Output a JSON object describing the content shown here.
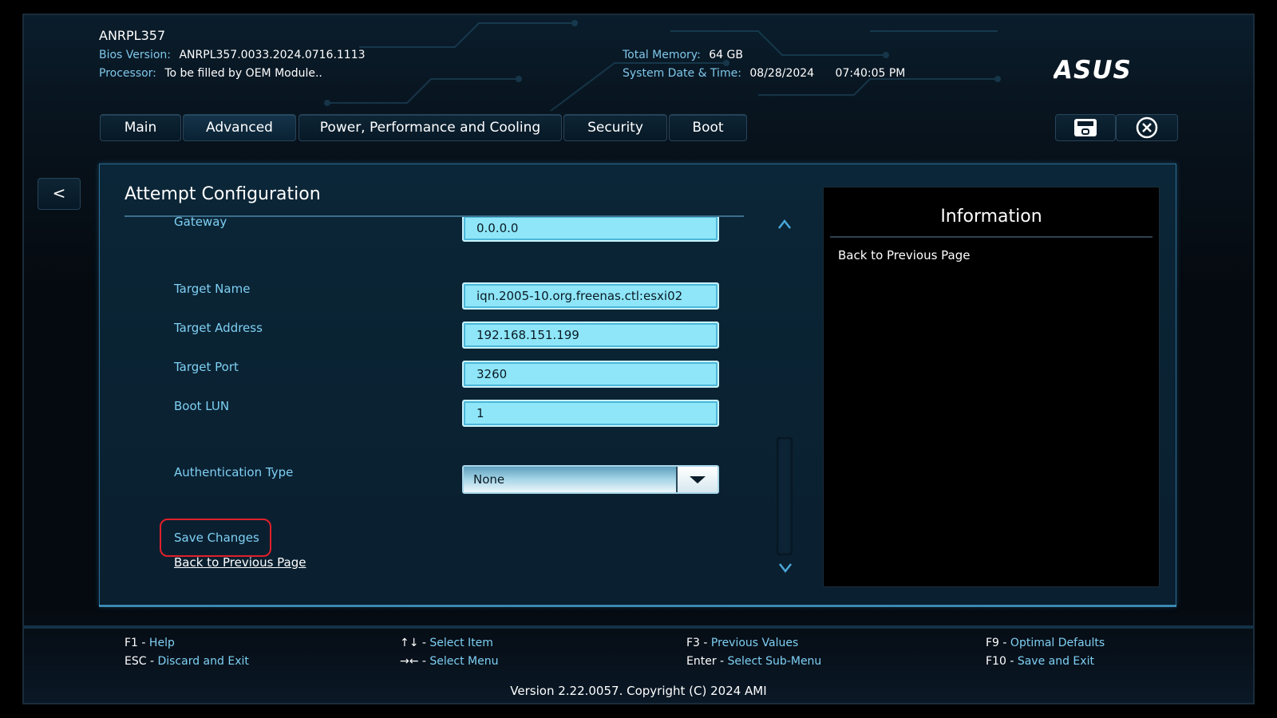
{
  "header": {
    "model": "ANRPL357",
    "bios_version_label": "Bios Version:",
    "bios_version_value": "ANRPL357.0033.2024.0716.1113",
    "processor_label": "Processor:",
    "processor_value": "To be filled by OEM Module..",
    "total_memory_label": "Total Memory:",
    "total_memory_value": "64 GB",
    "datetime_label": "System Date & Time:",
    "date_value": "08/28/2024",
    "time_value": "07:40:05 PM",
    "brand": "ASUS"
  },
  "tabs": [
    {
      "label": "Main"
    },
    {
      "label": "Advanced"
    },
    {
      "label": "Power, Performance and Cooling"
    },
    {
      "label": "Security"
    },
    {
      "label": "Boot"
    }
  ],
  "toolbar": {
    "back_label": "<",
    "save_icon": "save-icon",
    "exit_icon": "close-circle-icon"
  },
  "page": {
    "title": "Attempt Configuration",
    "rows": [
      {
        "label": "Gateway",
        "value": "0.0.0.0"
      },
      {
        "label": "Target Name",
        "value": "iqn.2005-10.org.freenas.ctl:esxi02"
      },
      {
        "label": "Target Address",
        "value": "192.168.151.199"
      },
      {
        "label": "Target Port",
        "value": "3260"
      },
      {
        "label": "Boot LUN",
        "value": "1"
      }
    ],
    "auth_label": "Authentication Type",
    "auth_value": "None",
    "save_changes": "Save Changes",
    "back_link": "Back to Previous Page"
  },
  "info": {
    "title": "Information",
    "text": "Back to Previous Page"
  },
  "footer": {
    "f1_key": "F1",
    "f1_desc": "Help",
    "esc_key": "ESC",
    "esc_desc": "Discard and Exit",
    "updown_key": "↑↓",
    "updown_desc": "Select Item",
    "leftright_key": "→←",
    "leftright_desc": "Select Menu",
    "f3_key": "F3",
    "f3_desc": "Previous Values",
    "enter_key": "Enter",
    "enter_desc": "Select Sub-Menu",
    "f9_key": "F9",
    "f9_desc": "Optimal Defaults",
    "f10_key": "F10",
    "f10_desc": "Save and Exit",
    "version": "Version 2.22.0057. Copyright (C) 2024 AMI"
  },
  "colors": {
    "accent": "#7fd0f4",
    "field_bg": "#8ee6f8",
    "highlight": "#e0202a"
  }
}
